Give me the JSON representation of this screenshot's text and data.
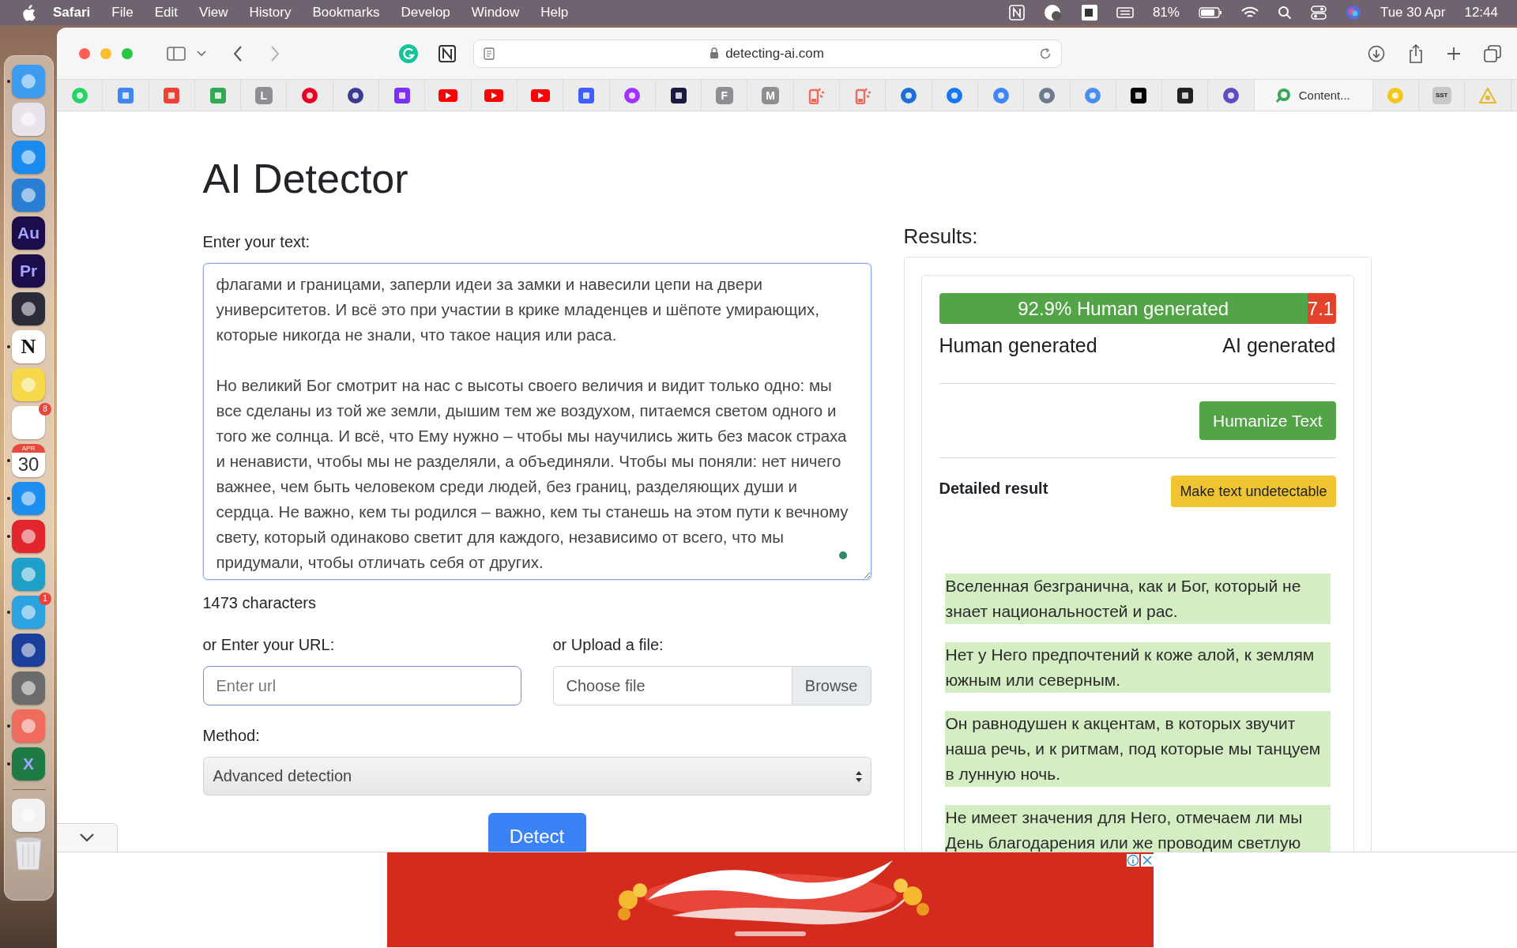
{
  "menu_bar": {
    "app": "Safari",
    "menus": [
      "File",
      "Edit",
      "View",
      "History",
      "Bookmarks",
      "Develop",
      "Window",
      "Help"
    ],
    "battery": "81%",
    "date": "Tue 30 Apr",
    "time": "12:44"
  },
  "dock": [
    {
      "kind": "tile",
      "color": "#3d9bf0",
      "running": true
    },
    {
      "kind": "tile",
      "color": "#e9e4ec",
      "running": false
    },
    {
      "kind": "tile",
      "color": "#1a8cf0",
      "running": false
    },
    {
      "kind": "tile",
      "color": "#2a7ed3",
      "running": false
    },
    {
      "kind": "tile",
      "color": "#1c0d4a",
      "label": "Au",
      "running": false
    },
    {
      "kind": "tile",
      "color": "#1c0d4a",
      "label": "Pr",
      "running": false
    },
    {
      "kind": "tile",
      "color": "#2b2b3a",
      "running": false
    },
    {
      "kind": "tile",
      "color": "#ffffff",
      "label": "N",
      "running": true
    },
    {
      "kind": "tile",
      "color": "#f7d84b",
      "running": false
    },
    {
      "kind": "tile",
      "color": "#ffffff",
      "badge": "8",
      "running": false
    },
    {
      "kind": "calendar",
      "month": "APR",
      "day": "30",
      "running": true
    },
    {
      "kind": "tile",
      "color": "#1e8ef0",
      "running": true
    },
    {
      "kind": "tile",
      "color": "#e3262d",
      "running": true
    },
    {
      "kind": "tile",
      "color": "#1fa0c8",
      "running": false
    },
    {
      "kind": "tile",
      "color": "#2aa3e0",
      "badge": "1",
      "running": true
    },
    {
      "kind": "tile",
      "color": "#1b3f9a",
      "running": false
    },
    {
      "kind": "tile",
      "color": "#6b6b6b",
      "running": false
    },
    {
      "kind": "tile",
      "color": "#f06a5e",
      "running": true
    },
    {
      "kind": "tile",
      "color": "#1e7a45",
      "label": "X",
      "running": true
    },
    {
      "kind": "separator"
    },
    {
      "kind": "tile",
      "color": "#f2f2f2",
      "running": false
    },
    {
      "kind": "trash"
    }
  ],
  "toolbar": {
    "address": "detecting-ai.com"
  },
  "bookmarks": [
    {
      "kind": "round",
      "color": "#25d366"
    },
    {
      "kind": "square",
      "color": "#4285f4"
    },
    {
      "kind": "square",
      "color": "#ea4335"
    },
    {
      "kind": "square",
      "color": "#34a853"
    },
    {
      "kind": "letter",
      "color": "#8e8e93",
      "letter": "L"
    },
    {
      "kind": "round",
      "color": "#e60023"
    },
    {
      "kind": "round",
      "color": "#3b3b8f"
    },
    {
      "kind": "square",
      "color": "#7b2ff7"
    },
    {
      "kind": "play",
      "color": "#ff0000"
    },
    {
      "kind": "play",
      "color": "#ff0000"
    },
    {
      "kind": "play",
      "color": "#ff0000"
    },
    {
      "kind": "square",
      "color": "#3f5efb"
    },
    {
      "kind": "round",
      "color": "#a033ff"
    },
    {
      "kind": "square",
      "color": "#1a1a40"
    },
    {
      "kind": "letter",
      "color": "#8e8e93",
      "letter": "F"
    },
    {
      "kind": "letter",
      "color": "#8e8e93",
      "letter": "M"
    },
    {
      "kind": "phone",
      "color": "#f06a5e"
    },
    {
      "kind": "phone",
      "color": "#f06a5e"
    },
    {
      "kind": "round",
      "color": "#1e6fd9"
    },
    {
      "kind": "round",
      "color": "#1877f2"
    },
    {
      "kind": "round",
      "color": "#4285f4"
    },
    {
      "kind": "round",
      "color": "#6d7b8d"
    },
    {
      "kind": "round",
      "color": "#4a8ef0"
    },
    {
      "kind": "square",
      "color": "#000000"
    },
    {
      "kind": "square",
      "color": "#222222"
    },
    {
      "kind": "round",
      "color": "#5b4fc4"
    },
    {
      "kind": "tab",
      "color": "#3aa757",
      "label": "Content..."
    },
    {
      "kind": "round",
      "color": "#f5c518"
    },
    {
      "kind": "letter",
      "color": "#c8c8c8",
      "letter": "SST"
    },
    {
      "kind": "triangle",
      "color": "#e8b830"
    }
  ],
  "page": {
    "title": "AI Detector",
    "text_label": "Enter your text:",
    "text_value": "флагами и границами, заперли идеи за замки и навесили цепи на двери университетов. И всё это при участии в крике младенцев и шёпоте умирающих, которые никогда не знали, что такое нация или раса.\n\nНо великий Бог смотрит на нас с высоты своего величия и видит только одно: мы все сделаны из той же земли, дышим тем же воздухом, питаемся светом одного и того же солнца. И всё, что Ему нужно – чтобы мы научились жить без масок страха и ненависти, чтобы мы не разделяли, а объединяли. Чтобы мы поняли: нет ничего важнее, чем быть человеком среди людей, без границ, разделяющих души и сердца. Не важно, кем ты родился – важно, кем ты станешь на этом пути к вечному свету, который одинаково светит для каждого, независимо от всего, что мы придумали, чтобы отличать себя от других.",
    "char_count": "1473 characters",
    "url_label": "or Enter your URL:",
    "url_placeholder": "Enter url",
    "file_label": "or Upload a file:",
    "file_placeholder": "Choose file",
    "browse": "Browse",
    "method_label": "Method:",
    "method_value": "Advanced detection",
    "detect": "Detect"
  },
  "results": {
    "title": "Results:",
    "segments": [
      {
        "kind": "human",
        "level": 0.929,
        "label": "92.9% Human generated"
      },
      {
        "kind": "ai",
        "label": "7.1"
      }
    ],
    "legend_left": "Human generated",
    "legend_right": "AI generated",
    "humanize": "Humanize Text",
    "detailed_title": "Detailed result",
    "undetectable": "Make text undetectable",
    "sentences": [
      "Вселенная безгранична, как и Бог, который не знает национальностей и рас.",
      "Нет у Него предпочтений к коже алой, к землям южным или северным.",
      "Он равнодушен к акцентам, в которых звучит наша речь, и к ритмам, под которые мы танцуем в лунную ночь.",
      "Не имеет значения для Него, отмечаем ли мы День благодарения или же проводим светлую"
    ]
  }
}
